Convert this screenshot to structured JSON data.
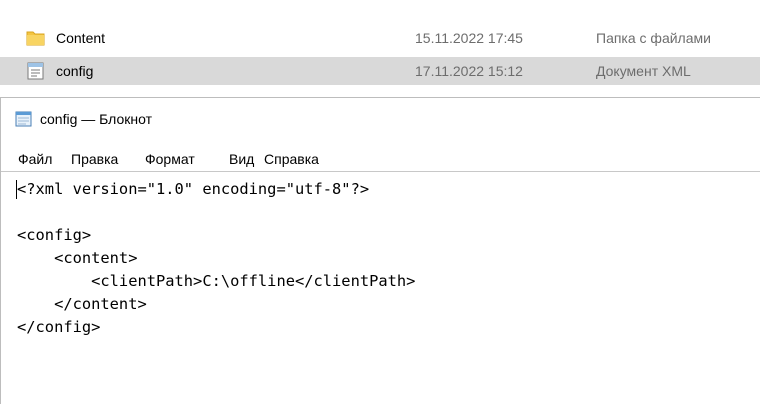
{
  "explorer": {
    "files": [
      {
        "name": "Content",
        "date": "15.11.2022 17:45",
        "type": "Папка с файлами",
        "icon": "folder-icon"
      },
      {
        "name": "config",
        "date": "17.11.2022 15:12",
        "type": "Документ XML",
        "icon": "xml-document-icon"
      }
    ]
  },
  "notepad": {
    "title": "config — Блокнот",
    "icon": "notepad-icon",
    "menu": [
      "Файл",
      "Правка",
      "Формат",
      "Вид",
      "Справка"
    ],
    "content": "<?xml version=\"1.0\" encoding=\"utf-8\"?>\n\n<config>\n    <content>\n        <clientPath>C:\\offline</clientPath>\n    </content>\n</config>"
  },
  "colors": {
    "selected_row": "#d9d9d9",
    "folder": "#f4c542",
    "secondary_text": "#6d6d6d"
  }
}
